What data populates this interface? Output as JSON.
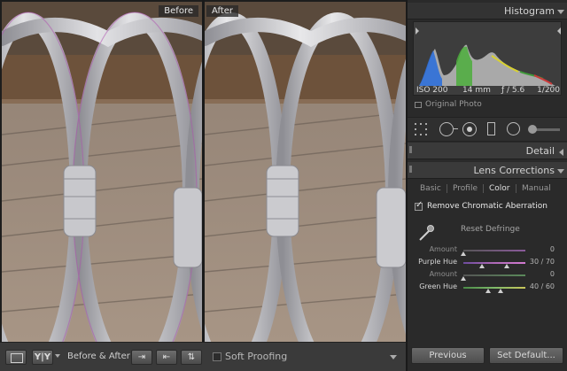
{
  "compare": {
    "before_label": "Before",
    "after_label": "After"
  },
  "toolbar": {
    "loupe_icon": "loupe-view-icon",
    "yy_label": "Y|Y",
    "before_after_label": "Before & After :",
    "swap_icons": [
      "copy-after-to-before-icon",
      "copy-before-to-after-icon",
      "swap-before-after-icon"
    ],
    "soft_proofing_label": "Soft Proofing",
    "soft_proofing_checked": false
  },
  "histogram": {
    "title": "Histogram",
    "iso": "ISO 200",
    "focal_length": "14 mm",
    "aperture": "ƒ / 5.6",
    "shutter": "1/200",
    "original_photo_label": "Original Photo"
  },
  "tools": [
    "crop-overlay-icon",
    "spot-removal-icon",
    "red-eye-icon",
    "graduated-filter-icon",
    "radial-filter-icon",
    "adjustment-brush-icon"
  ],
  "detail": {
    "title": "Detail"
  },
  "lens_corrections": {
    "title": "Lens Corrections",
    "tabs": [
      {
        "label": "Basic",
        "active": false
      },
      {
        "label": "Profile",
        "active": false
      },
      {
        "label": "Color",
        "active": true
      },
      {
        "label": "Manual",
        "active": false
      }
    ],
    "remove_ca_label": "Remove Chromatic Aberration",
    "remove_ca_checked": true,
    "reset_defringe_label": "Reset Defringe",
    "sliders": [
      {
        "label": "Amount",
        "value": "0",
        "fraction": 0.0,
        "active": false,
        "kind": "purple"
      },
      {
        "label": "Purple Hue",
        "value": "30 / 70",
        "low": 0.3,
        "high": 0.7,
        "active": true,
        "kind": "purple-range"
      },
      {
        "label": "Amount",
        "value": "0",
        "fraction": 0.0,
        "active": false,
        "kind": "green"
      },
      {
        "label": "Green Hue",
        "value": "40 / 60",
        "low": 0.4,
        "high": 0.6,
        "active": true,
        "kind": "green-range"
      }
    ]
  },
  "footer": {
    "previous_label": "Previous",
    "set_default_label": "Set Default..."
  },
  "colors": {
    "panel_bg": "#2a2a2a",
    "header_bg": "#3a3a3a",
    "text_light": "#d2d2d2",
    "deck": "#9c8a7b",
    "railing": "#c9c9cc"
  }
}
